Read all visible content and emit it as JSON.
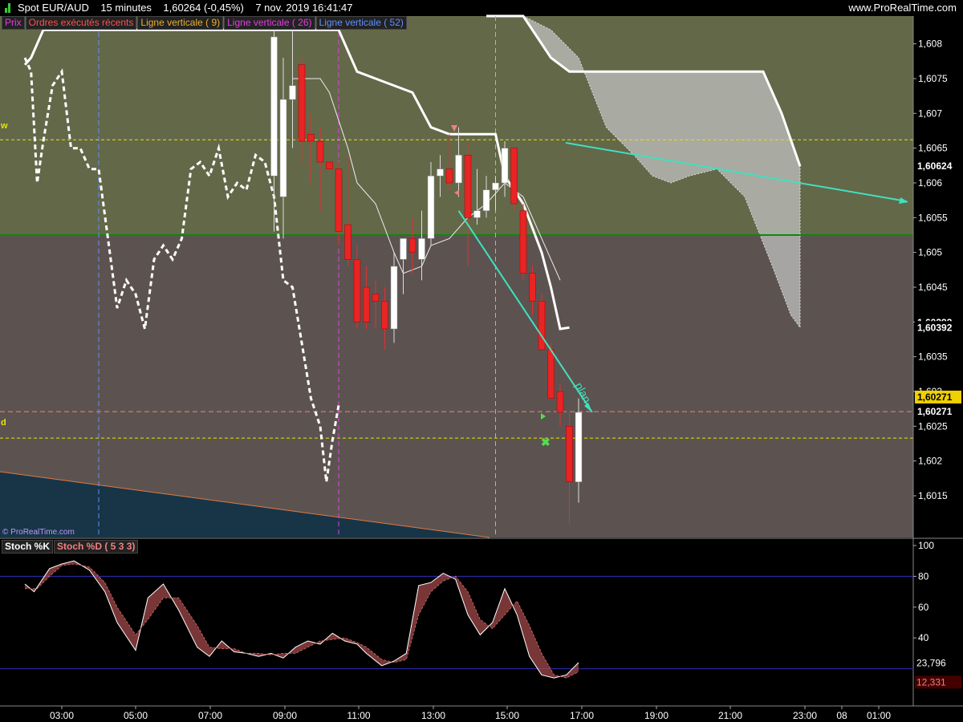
{
  "header": {
    "symbol": "Spot EUR/AUD",
    "timeframe": "15 minutes",
    "last_price": "1,60264",
    "change": "(-0,45%)",
    "datetime": "7 nov. 2019 16:41:47",
    "site": "www.ProRealTime.com"
  },
  "legend": [
    {
      "label": "Prix",
      "color": "#e040e0"
    },
    {
      "label": "Ordres exécutés récents",
      "color": "#ff5050"
    },
    {
      "label": "Ligne verticale ( 9)",
      "color": "#e8b030"
    },
    {
      "label": "Ligne verticale ( 26)",
      "color": "#e040e0"
    },
    {
      "label": "Ligne verticale ( 52)",
      "color": "#6090ff"
    }
  ],
  "copyright": "© ProRealTime.com",
  "markers": {
    "w": "w",
    "d": "d",
    "plan": "plan"
  },
  "colors": {
    "bg_upper": "#636849",
    "bg_lower": "#5c5350",
    "bg_bottom": "#173547",
    "up_candle": "#ffffff",
    "down_candle": "#e82424",
    "cloud": "#c0c0c0",
    "green_line": "#0a8a0a",
    "yellow": "#e6e600",
    "pink": "#f08080",
    "arrow": "#40e0c0",
    "stoch_k": "#ffffff",
    "stoch_d": "#c06060"
  },
  "chart_data": [
    {
      "type": "candlestick",
      "title": "Spot EUR/AUD 15 minutes",
      "time_labels": [
        "03:00",
        "05:00",
        "07:00",
        "09:00",
        "11:00",
        "13:00",
        "15:00",
        "17:00",
        "19:00",
        "21:00",
        "23:00",
        "08",
        "01:00"
      ],
      "y_ticks": [
        "1,608",
        "1,6075",
        "1,607",
        "1,6065",
        "1,606",
        "1,6055",
        "1,605",
        "1,6045",
        "1,604",
        "1,6035",
        "1,603",
        "1,6025",
        "1,602",
        "1,6015"
      ],
      "ylim": [
        1.6009,
        1.6084
      ],
      "price_labels": {
        "cloud_value": "1,60624",
        "tenkan_value": "1,60392",
        "tenkan_value2": "1,60393",
        "kijun_value": "1,60271",
        "current": "1,60271"
      },
      "horizontal_lines": {
        "green": 1.60525,
        "yellow_upper": 1.60662,
        "yellow_lower": 1.60233,
        "pink_dashed": 1.60271
      },
      "vertical_lines": [
        {
          "name": "Ligne verticale (52)",
          "time": "04:00"
        },
        {
          "name": "Ligne verticale (26)",
          "time": "10:30"
        },
        {
          "name": "Ligne verticale (9)",
          "time": "14:45"
        }
      ],
      "candles": [
        {
          "t": "08:45",
          "o": 1.6061,
          "h": 1.6082,
          "l": 1.6053,
          "c": 1.6081
        },
        {
          "t": "09:00",
          "o": 1.6058,
          "h": 1.6078,
          "l": 1.6052,
          "c": 1.6072
        },
        {
          "t": "09:15",
          "o": 1.6072,
          "h": 1.6082,
          "l": 1.6065,
          "c": 1.6074
        },
        {
          "t": "09:30",
          "o": 1.6077,
          "h": 1.6078,
          "l": 1.6063,
          "c": 1.6066
        },
        {
          "t": "09:45",
          "o": 1.6067,
          "h": 1.607,
          "l": 1.606,
          "c": 1.6066
        },
        {
          "t": "10:00",
          "o": 1.6066,
          "h": 1.6068,
          "l": 1.6056,
          "c": 1.6063
        },
        {
          "t": "10:15",
          "o": 1.6063,
          "h": 1.6066,
          "l": 1.6061,
          "c": 1.6062
        },
        {
          "t": "10:30",
          "o": 1.6062,
          "h": 1.6063,
          "l": 1.6051,
          "c": 1.6053
        },
        {
          "t": "10:45",
          "o": 1.6054,
          "h": 1.6064,
          "l": 1.6048,
          "c": 1.6049
        },
        {
          "t": "11:00",
          "o": 1.6049,
          "h": 1.6051,
          "l": 1.6039,
          "c": 1.604
        },
        {
          "t": "11:15",
          "o": 1.6045,
          "h": 1.6048,
          "l": 1.6039,
          "c": 1.604
        },
        {
          "t": "11:30",
          "o": 1.6044,
          "h": 1.6046,
          "l": 1.6039,
          "c": 1.6043
        },
        {
          "t": "11:45",
          "o": 1.6043,
          "h": 1.6045,
          "l": 1.6036,
          "c": 1.6039
        },
        {
          "t": "12:00",
          "o": 1.6039,
          "h": 1.605,
          "l": 1.6037,
          "c": 1.6048
        },
        {
          "t": "12:15",
          "o": 1.6049,
          "h": 1.6052,
          "l": 1.6044,
          "c": 1.6052
        },
        {
          "t": "12:30",
          "o": 1.6052,
          "h": 1.6055,
          "l": 1.6047,
          "c": 1.605
        },
        {
          "t": "12:45",
          "o": 1.6049,
          "h": 1.6056,
          "l": 1.6046,
          "c": 1.6052
        },
        {
          "t": "13:00",
          "o": 1.6052,
          "h": 1.6063,
          "l": 1.6051,
          "c": 1.6061
        },
        {
          "t": "13:15",
          "o": 1.6061,
          "h": 1.6064,
          "l": 1.6058,
          "c": 1.6062
        },
        {
          "t": "13:30",
          "o": 1.6062,
          "h": 1.6067,
          "l": 1.6059,
          "c": 1.606
        },
        {
          "t": "13:45",
          "o": 1.606,
          "h": 1.6068,
          "l": 1.6058,
          "c": 1.6064
        },
        {
          "t": "14:00",
          "o": 1.6064,
          "h": 1.6066,
          "l": 1.6048,
          "c": 1.6055
        },
        {
          "t": "14:15",
          "o": 1.6055,
          "h": 1.6062,
          "l": 1.6054,
          "c": 1.6056
        },
        {
          "t": "14:30",
          "o": 1.6056,
          "h": 1.6061,
          "l": 1.6055,
          "c": 1.6059
        },
        {
          "t": "14:45",
          "o": 1.6059,
          "h": 1.6061,
          "l": 1.6056,
          "c": 1.606
        },
        {
          "t": "15:00",
          "o": 1.606,
          "h": 1.6066,
          "l": 1.6058,
          "c": 1.6065
        },
        {
          "t": "15:15",
          "o": 1.6065,
          "h": 1.6065,
          "l": 1.6056,
          "c": 1.6057
        },
        {
          "t": "15:30",
          "o": 1.6056,
          "h": 1.6057,
          "l": 1.6046,
          "c": 1.6047
        },
        {
          "t": "15:45",
          "o": 1.6047,
          "h": 1.6048,
          "l": 1.6041,
          "c": 1.6043
        },
        {
          "t": "16:00",
          "o": 1.6043,
          "h": 1.6044,
          "l": 1.6036,
          "c": 1.6036
        },
        {
          "t": "16:15",
          "o": 1.6036,
          "h": 1.6037,
          "l": 1.6029,
          "c": 1.6029
        },
        {
          "t": "16:30",
          "o": 1.603,
          "h": 1.6031,
          "l": 1.6025,
          "c": 1.6027
        },
        {
          "t": "16:45",
          "o": 1.6025,
          "h": 1.6027,
          "l": 1.6011,
          "c": 1.6017
        },
        {
          "t": "17:00",
          "o": 1.6017,
          "h": 1.6029,
          "l": 1.6014,
          "c": 1.6027
        }
      ]
    },
    {
      "type": "line",
      "title": "Stoch %K / Stoch %D (5 3 3)",
      "series_names": [
        "Stoch %K",
        "Stoch %D ( 5 3 3)"
      ],
      "ylim": [
        0,
        100
      ],
      "y_ticks": [
        "100",
        "80",
        "60",
        "40"
      ],
      "levels": [
        80,
        20
      ],
      "value_labels": {
        "k": "23,796",
        "d": "12,331"
      }
    }
  ]
}
